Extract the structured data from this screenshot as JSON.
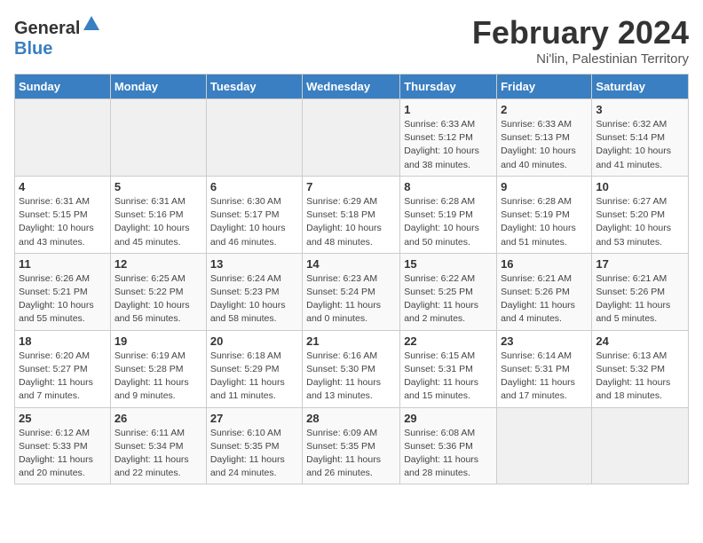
{
  "header": {
    "logo_general": "General",
    "logo_blue": "Blue",
    "title": "February 2024",
    "subtitle": "Ni'lin, Palestinian Territory"
  },
  "days_of_week": [
    "Sunday",
    "Monday",
    "Tuesday",
    "Wednesday",
    "Thursday",
    "Friday",
    "Saturday"
  ],
  "weeks": [
    [
      {
        "day": "",
        "info": ""
      },
      {
        "day": "",
        "info": ""
      },
      {
        "day": "",
        "info": ""
      },
      {
        "day": "",
        "info": ""
      },
      {
        "day": "1",
        "info": "Sunrise: 6:33 AM\nSunset: 5:12 PM\nDaylight: 10 hours\nand 38 minutes."
      },
      {
        "day": "2",
        "info": "Sunrise: 6:33 AM\nSunset: 5:13 PM\nDaylight: 10 hours\nand 40 minutes."
      },
      {
        "day": "3",
        "info": "Sunrise: 6:32 AM\nSunset: 5:14 PM\nDaylight: 10 hours\nand 41 minutes."
      }
    ],
    [
      {
        "day": "4",
        "info": "Sunrise: 6:31 AM\nSunset: 5:15 PM\nDaylight: 10 hours\nand 43 minutes."
      },
      {
        "day": "5",
        "info": "Sunrise: 6:31 AM\nSunset: 5:16 PM\nDaylight: 10 hours\nand 45 minutes."
      },
      {
        "day": "6",
        "info": "Sunrise: 6:30 AM\nSunset: 5:17 PM\nDaylight: 10 hours\nand 46 minutes."
      },
      {
        "day": "7",
        "info": "Sunrise: 6:29 AM\nSunset: 5:18 PM\nDaylight: 10 hours\nand 48 minutes."
      },
      {
        "day": "8",
        "info": "Sunrise: 6:28 AM\nSunset: 5:19 PM\nDaylight: 10 hours\nand 50 minutes."
      },
      {
        "day": "9",
        "info": "Sunrise: 6:28 AM\nSunset: 5:19 PM\nDaylight: 10 hours\nand 51 minutes."
      },
      {
        "day": "10",
        "info": "Sunrise: 6:27 AM\nSunset: 5:20 PM\nDaylight: 10 hours\nand 53 minutes."
      }
    ],
    [
      {
        "day": "11",
        "info": "Sunrise: 6:26 AM\nSunset: 5:21 PM\nDaylight: 10 hours\nand 55 minutes."
      },
      {
        "day": "12",
        "info": "Sunrise: 6:25 AM\nSunset: 5:22 PM\nDaylight: 10 hours\nand 56 minutes."
      },
      {
        "day": "13",
        "info": "Sunrise: 6:24 AM\nSunset: 5:23 PM\nDaylight: 10 hours\nand 58 minutes."
      },
      {
        "day": "14",
        "info": "Sunrise: 6:23 AM\nSunset: 5:24 PM\nDaylight: 11 hours\nand 0 minutes."
      },
      {
        "day": "15",
        "info": "Sunrise: 6:22 AM\nSunset: 5:25 PM\nDaylight: 11 hours\nand 2 minutes."
      },
      {
        "day": "16",
        "info": "Sunrise: 6:21 AM\nSunset: 5:26 PM\nDaylight: 11 hours\nand 4 minutes."
      },
      {
        "day": "17",
        "info": "Sunrise: 6:21 AM\nSunset: 5:26 PM\nDaylight: 11 hours\nand 5 minutes."
      }
    ],
    [
      {
        "day": "18",
        "info": "Sunrise: 6:20 AM\nSunset: 5:27 PM\nDaylight: 11 hours\nand 7 minutes."
      },
      {
        "day": "19",
        "info": "Sunrise: 6:19 AM\nSunset: 5:28 PM\nDaylight: 11 hours\nand 9 minutes."
      },
      {
        "day": "20",
        "info": "Sunrise: 6:18 AM\nSunset: 5:29 PM\nDaylight: 11 hours\nand 11 minutes."
      },
      {
        "day": "21",
        "info": "Sunrise: 6:16 AM\nSunset: 5:30 PM\nDaylight: 11 hours\nand 13 minutes."
      },
      {
        "day": "22",
        "info": "Sunrise: 6:15 AM\nSunset: 5:31 PM\nDaylight: 11 hours\nand 15 minutes."
      },
      {
        "day": "23",
        "info": "Sunrise: 6:14 AM\nSunset: 5:31 PM\nDaylight: 11 hours\nand 17 minutes."
      },
      {
        "day": "24",
        "info": "Sunrise: 6:13 AM\nSunset: 5:32 PM\nDaylight: 11 hours\nand 18 minutes."
      }
    ],
    [
      {
        "day": "25",
        "info": "Sunrise: 6:12 AM\nSunset: 5:33 PM\nDaylight: 11 hours\nand 20 minutes."
      },
      {
        "day": "26",
        "info": "Sunrise: 6:11 AM\nSunset: 5:34 PM\nDaylight: 11 hours\nand 22 minutes."
      },
      {
        "day": "27",
        "info": "Sunrise: 6:10 AM\nSunset: 5:35 PM\nDaylight: 11 hours\nand 24 minutes."
      },
      {
        "day": "28",
        "info": "Sunrise: 6:09 AM\nSunset: 5:35 PM\nDaylight: 11 hours\nand 26 minutes."
      },
      {
        "day": "29",
        "info": "Sunrise: 6:08 AM\nSunset: 5:36 PM\nDaylight: 11 hours\nand 28 minutes."
      },
      {
        "day": "",
        "info": ""
      },
      {
        "day": "",
        "info": ""
      }
    ]
  ]
}
